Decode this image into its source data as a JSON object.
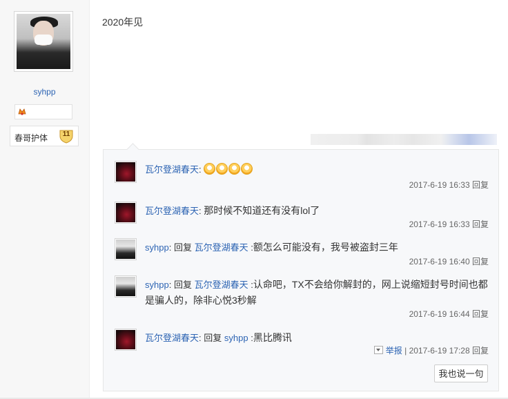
{
  "author": {
    "name": "syhpp",
    "fan_badge_label": "春哥护体",
    "fan_level": "11"
  },
  "post": {
    "content": "2020年见"
  },
  "replies": [
    {
      "avatar": "dark",
      "name": "瓦尔登湖春天",
      "reply_prefix": "",
      "reply_to": "",
      "sep": ":",
      "content": "",
      "emoji_count": 4,
      "time": "2017-6-19 16:33",
      "reply_label": "回复"
    },
    {
      "avatar": "dark",
      "name": "瓦尔登湖春天",
      "reply_prefix": "",
      "reply_to": "",
      "sep": ":",
      "content": "那时候不知道还有没有lol了",
      "emoji_count": 0,
      "time": "2017-6-19 16:33",
      "reply_label": "回复"
    },
    {
      "avatar": "light",
      "name": "syhpp",
      "reply_prefix": "回复",
      "reply_to": "瓦尔登湖春天",
      "sep": ":",
      "content": "额怎么可能没有，我号被盗封三年",
      "emoji_count": 0,
      "time": "2017-6-19 16:40",
      "reply_label": "回复"
    },
    {
      "avatar": "light",
      "name": "syhpp",
      "reply_prefix": "回复",
      "reply_to": "瓦尔登湖春天",
      "sep": ":",
      "content": "认命吧，TX不会给你解封的，网上说缩短封号时间也都是骗人的，除非心悦3秒解",
      "emoji_count": 0,
      "time": "2017-6-19 16:44",
      "reply_label": "回复"
    },
    {
      "avatar": "dark",
      "name": "瓦尔登湖春天",
      "reply_prefix": "回复",
      "reply_to": "syhpp",
      "sep": ":",
      "content": "黑比腾讯",
      "emoji_count": 0,
      "time": "2017-6-19 17:28",
      "reply_label": "回复",
      "report": "举报"
    }
  ],
  "say_button": "我也说一句",
  "colors": {
    "link": "#2d64b3",
    "sidebar_bg": "#f7f7f7",
    "reply_bg": "#f7f8fa"
  }
}
